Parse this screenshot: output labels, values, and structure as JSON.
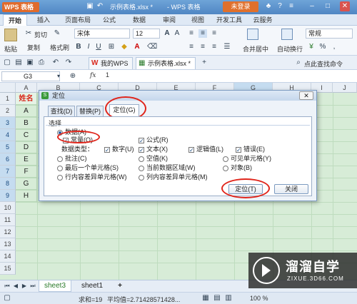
{
  "titlebar": {
    "app_name": "WPS 表格",
    "file_tab1": "示例表格.xlsx *",
    "file_tab2": "- WPS 表格",
    "login_label": "未登录"
  },
  "ribbon_tabs": [
    "开始",
    "插入",
    "页面布局",
    "公式",
    "数据",
    "审阅",
    "视图",
    "开发工具",
    "云服务"
  ],
  "ribbon": {
    "paste_label": "粘贴",
    "cut_label": "剪切",
    "copy_label": "复制",
    "format_painter_label": "格式刷",
    "font_name": "宋体",
    "font_size": "12",
    "merge_center_label": "合并居中",
    "wrap_label": "自动换行",
    "number_format": "常规"
  },
  "quickbar": {
    "doctab1_label": "我的WPS",
    "doctab2_label": "示例表格.xlsx *",
    "search_hint": "点此查找命令"
  },
  "formula_bar": {
    "cell_ref": "G3",
    "fx_label": "fx",
    "value": "1"
  },
  "grid": {
    "columns": [
      "A",
      "B",
      "C",
      "D",
      "E",
      "F",
      "G",
      "H",
      "I",
      "J"
    ],
    "rows": [
      "1",
      "2",
      "3",
      "4",
      "5",
      "6",
      "7",
      "8",
      "9",
      "10",
      "11",
      "12",
      "13",
      "14",
      "15"
    ],
    "col_a_values": [
      "姓名",
      "A",
      "B",
      "C",
      "D",
      "E",
      "F",
      "G",
      "H"
    ]
  },
  "dialog": {
    "title": "定位",
    "close_label": "✕",
    "tabs": [
      "查找(D)",
      "替换(P)",
      "定位(G)"
    ],
    "section_label": "选择",
    "data_option": "数据(A)",
    "constant_option": "常量(O)",
    "formula_option": "公式(R)",
    "data_type_label": "数据类型：",
    "type_number": "数字(U)",
    "type_text": "文本(X)",
    "type_logical": "逻辑值(L)",
    "type_error": "错误(E)",
    "comment_option": "批注(C)",
    "blank_option": "空值(K)",
    "visible_cells_option": "可见单元格(Y)",
    "last_cell_option": "最后一个单元格(S)",
    "current_region_option": "当前数据区域(W)",
    "objects_option": "对象(B)",
    "row_diff_option": "行内容差异单元格(W)",
    "col_diff_option": "列内容差异单元格(M)",
    "goto_button": "定位(T)",
    "close_button": "关闭"
  },
  "sheets": {
    "tab1": "sheet3",
    "tab2": "sheet1",
    "add_label": "+"
  },
  "status": {
    "sum": "求和=19",
    "average": "平均值=2.71428571428...",
    "zoom": "100 %"
  },
  "watermark": {
    "brand": "溜溜自学",
    "url": "ZIXUE.3D66.COM"
  },
  "colors": {
    "accent": "#4f86c3",
    "grid_highlight": "#d7ecd7",
    "red_annotation": "#e0251b",
    "name_header_red": "#d9281c"
  }
}
